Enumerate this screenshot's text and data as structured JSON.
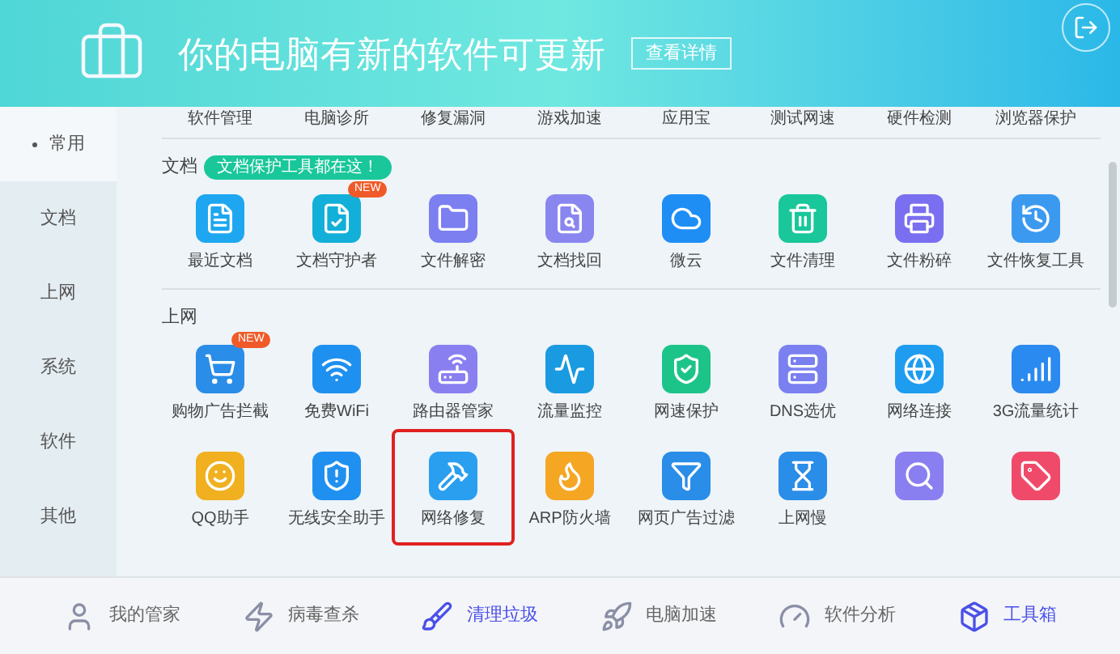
{
  "banner": {
    "title": "你的电脑有新的软件可更新",
    "button": "查看详情"
  },
  "sidebar": [
    {
      "label": "常用",
      "selected": true
    },
    {
      "label": "文档",
      "selected": false
    },
    {
      "label": "上网",
      "selected": false
    },
    {
      "label": "系统",
      "selected": false
    },
    {
      "label": "软件",
      "selected": false
    },
    {
      "label": "其他",
      "selected": false
    }
  ],
  "top_row": [
    "软件管理",
    "电脑诊所",
    "修复漏洞",
    "游戏加速",
    "应用宝",
    "测试网速",
    "硬件检测",
    "浏览器保护"
  ],
  "sections": [
    {
      "title": "文档",
      "tip": "文档保护工具都在这！",
      "items": [
        {
          "label": "最近文档",
          "highlighted": false
        },
        {
          "label": "文档守护者",
          "badge": "NEW",
          "highlighted": false
        },
        {
          "label": "文件解密",
          "highlighted": false
        },
        {
          "label": "文档找回",
          "highlighted": false
        },
        {
          "label": "微云",
          "highlighted": false
        },
        {
          "label": "文件清理",
          "highlighted": false
        },
        {
          "label": "文件粉碎",
          "highlighted": false
        },
        {
          "label": "文件恢复工具",
          "highlighted": false
        }
      ]
    },
    {
      "title": "上网",
      "items": [
        {
          "label": "购物广告拦截",
          "badge": "NEW",
          "highlighted": false
        },
        {
          "label": "免费WiFi",
          "highlighted": false
        },
        {
          "label": "路由器管家",
          "highlighted": false
        },
        {
          "label": "流量监控",
          "highlighted": false
        },
        {
          "label": "网速保护",
          "highlighted": false
        },
        {
          "label": "DNS选优",
          "highlighted": false
        },
        {
          "label": "网络连接",
          "highlighted": false
        },
        {
          "label": "3G流量统计",
          "highlighted": false
        },
        {
          "label": "QQ助手",
          "highlighted": false
        },
        {
          "label": "无线安全助手",
          "highlighted": false
        },
        {
          "label": "网络修复",
          "highlighted": true
        },
        {
          "label": "ARP防火墙",
          "highlighted": false
        },
        {
          "label": "网页广告过滤",
          "highlighted": false
        },
        {
          "label": "上网慢",
          "highlighted": false
        },
        {
          "highlighted": false
        },
        {
          "highlighted": false
        }
      ]
    }
  ],
  "bottom_nav": [
    {
      "label": "我的管家",
      "active": false
    },
    {
      "label": "病毒查杀",
      "active": false
    },
    {
      "label": "清理垃圾",
      "active": true
    },
    {
      "label": "电脑加速",
      "active": false
    },
    {
      "label": "软件分析",
      "active": false
    },
    {
      "label": "工具箱",
      "active": true
    }
  ]
}
